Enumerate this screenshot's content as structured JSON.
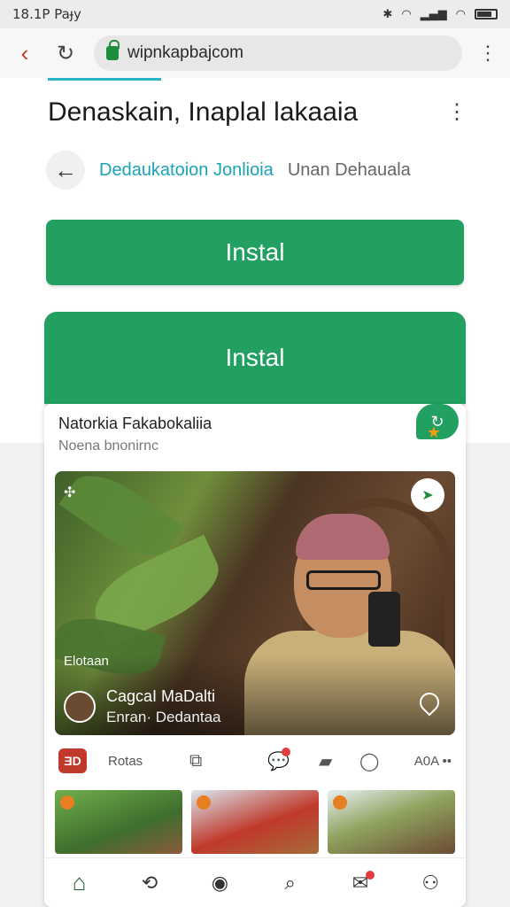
{
  "status_bar": {
    "time": "18.1P Paɟy",
    "extra": "⌁"
  },
  "browser": {
    "url": "wipnkapbajcom",
    "url_highlight": "w"
  },
  "page": {
    "title": "Denaskain, Inaplal lakaaia",
    "breadcrumb_link": "Dedaukatoion Jonlioia",
    "breadcrumb_sub": "Unan Dehauala",
    "install_label_1": "Instal",
    "install_label_2": "Instal"
  },
  "card": {
    "title": "Natorkia Fakabokaliia",
    "subtitle": "Noena bnonirnc",
    "hero_tag": "Elotaan",
    "hero_name": "CagcaI MaDalti",
    "hero_sub": "Enran· Dedantaa",
    "actions_label": "Rotas",
    "actions_count": "A0A ••",
    "action_logo": "ƎD"
  },
  "colors": {
    "accent": "#22a061",
    "link": "#1aa3b8",
    "alert": "#e23b3b"
  }
}
